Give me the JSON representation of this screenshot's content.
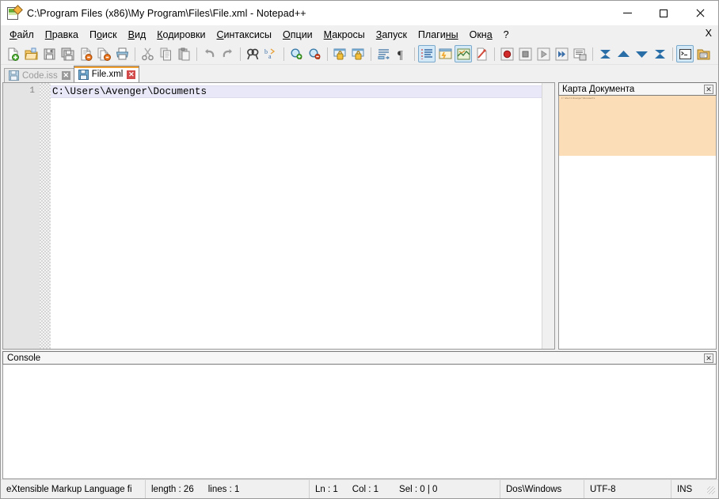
{
  "window": {
    "title": "C:\\Program Files (x86)\\My Program\\Files\\File.xml - Notepad++",
    "icon": "notepad-plus-plus-icon",
    "minimize_label": "Minimize",
    "maximize_label": "Maximize",
    "close_label": "Close"
  },
  "menubar": {
    "items": [
      {
        "label": "Файл",
        "accel": "Ф"
      },
      {
        "label": "Правка",
        "accel": "П"
      },
      {
        "label": "Поиск",
        "accel": "о"
      },
      {
        "label": "Вид",
        "accel": "В"
      },
      {
        "label": "Кодировки",
        "accel": "К"
      },
      {
        "label": "Синтаксисы",
        "accel": "С"
      },
      {
        "label": "Опции",
        "accel": "О"
      },
      {
        "label": "Макросы",
        "accel": "М"
      },
      {
        "label": "Запуск",
        "accel": "З"
      },
      {
        "label": "Плагины",
        "accel": "ны"
      },
      {
        "label": "Окна",
        "accel": "а"
      },
      {
        "label": "?",
        "accel": ""
      }
    ],
    "close_document_label": "X"
  },
  "toolbar": {
    "buttons": [
      {
        "name": "new-file-icon",
        "tooltip": "Новый"
      },
      {
        "name": "open-file-icon",
        "tooltip": "Открыть"
      },
      {
        "name": "save-icon",
        "tooltip": "Сохранить"
      },
      {
        "name": "save-all-icon",
        "tooltip": "Сохранить всё"
      },
      {
        "name": "close-file-icon",
        "tooltip": "Закрыть"
      },
      {
        "name": "close-all-icon",
        "tooltip": "Закрыть всё"
      },
      {
        "name": "print-icon",
        "tooltip": "Печать"
      },
      {
        "name": "cut-icon",
        "tooltip": "Вырезать"
      },
      {
        "name": "copy-icon",
        "tooltip": "Копировать"
      },
      {
        "name": "paste-icon",
        "tooltip": "Вставить"
      },
      {
        "name": "undo-icon",
        "tooltip": "Отменить"
      },
      {
        "name": "redo-icon",
        "tooltip": "Повторить"
      },
      {
        "name": "find-icon",
        "tooltip": "Найти"
      },
      {
        "name": "replace-icon",
        "tooltip": "Заменить"
      },
      {
        "name": "zoom-in-icon",
        "tooltip": "Увеличить"
      },
      {
        "name": "zoom-out-icon",
        "tooltip": "Уменьшить"
      },
      {
        "name": "sync-vertical-scroll-icon",
        "tooltip": "Синхронная вертикальная прокрутка"
      },
      {
        "name": "sync-horizontal-scroll-icon",
        "tooltip": "Синхронная горизонтальная прокрутка"
      },
      {
        "name": "word-wrap-icon",
        "tooltip": "Перенос строк"
      },
      {
        "name": "show-all-characters-icon",
        "tooltip": "Отображать все символы"
      },
      {
        "name": "indent-guide-icon",
        "tooltip": "Показать границы блоков",
        "active": true
      },
      {
        "name": "user-defined-language-icon",
        "tooltip": "Пользовательский синтаксис"
      },
      {
        "name": "document-map-icon",
        "tooltip": "Карта документа",
        "active": true
      },
      {
        "name": "function-list-icon",
        "tooltip": "Список функций"
      },
      {
        "name": "record-macro-icon",
        "tooltip": "Записать макрос"
      },
      {
        "name": "stop-macro-icon",
        "tooltip": "Остановить запись"
      },
      {
        "name": "play-macro-icon",
        "tooltip": "Выполнить макрос"
      },
      {
        "name": "run-macro-multiple-icon",
        "tooltip": "Выполнить макрос несколько раз"
      },
      {
        "name": "save-macro-icon",
        "tooltip": "Сохранить макрос"
      },
      {
        "name": "bookmark-first-icon",
        "tooltip": "Первая закладка"
      },
      {
        "name": "bookmark-prev-icon",
        "tooltip": "Предыдущая закладка"
      },
      {
        "name": "bookmark-next-icon",
        "tooltip": "Следующая закладка"
      },
      {
        "name": "bookmark-last-icon",
        "tooltip": "Последняя закладка"
      },
      {
        "name": "console-toggle-icon",
        "tooltip": "Консоль",
        "active": true
      },
      {
        "name": "folder-explorer-icon",
        "tooltip": "Проводник"
      }
    ]
  },
  "tabs": [
    {
      "label": "Code.iss",
      "active": false,
      "close_label": "✕"
    },
    {
      "label": "File.xml",
      "active": true,
      "close_label": "✕"
    }
  ],
  "editor": {
    "line_numbers": [
      "1"
    ],
    "lines": [
      "C:\\Users\\Avenger\\Documents"
    ]
  },
  "document_map": {
    "title": "Карта Документа",
    "close_label": "✕",
    "preview_text": "C:\\Users\\Avenger\\Documents",
    "viewport_color": "#fbddb8"
  },
  "console": {
    "title": "Console",
    "close_label": "✕",
    "content": ""
  },
  "statusbar": {
    "language": "eXtensible Markup Language fi",
    "length": "length : 26",
    "lines": "lines : 1",
    "ln": "Ln : 1",
    "col": "Col : 1",
    "sel": "Sel : 0 | 0",
    "eol": "Dos\\Windows",
    "encoding": "UTF-8",
    "insert_mode": "INS"
  },
  "colors": {
    "accent": "#f0a030",
    "current_line": "#e8e8f8",
    "map_viewport": "#fbddb8",
    "tab_close_active": "#d24a4a"
  }
}
